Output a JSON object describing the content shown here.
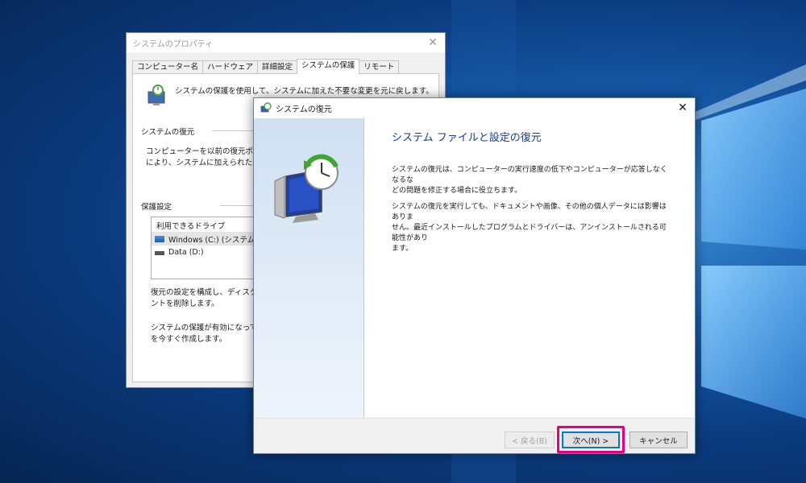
{
  "colors": {
    "accent": "#0078d7",
    "highlight": "#e5007e",
    "heading": "#1a3e7c"
  },
  "system_properties": {
    "title": "システムのプロパティ",
    "tabs": [
      {
        "label": "コンピューター名",
        "active": false
      },
      {
        "label": "ハードウェア",
        "active": false
      },
      {
        "label": "詳細設定",
        "active": false
      },
      {
        "label": "システムの保護",
        "active": true
      },
      {
        "label": "リモート",
        "active": false
      }
    ],
    "description": "システムの保護を使用して、システムに加えた不要な変更を元に戻します。",
    "restore_group": {
      "label": "システムの復元",
      "text_line1": "コンピューターを以前の復元ポイント",
      "text_line2": "により、システムに加えられた変更を"
    },
    "protection_group": {
      "label": "保護設定",
      "drives_header": "利用できるドライブ",
      "drives": [
        {
          "name": "Windows (C:) (システム)",
          "icon": "system-drive-icon"
        },
        {
          "name": "Data (D:)",
          "icon": "drive-icon"
        }
      ],
      "configure_line1": "復元の設定を構成し、ディスク領",
      "configure_line2": "ントを削除します。",
      "create_line1": "システムの保護が有効になってい",
      "create_line2": "を今すぐ作成します。"
    }
  },
  "system_restore": {
    "title": "システムの復元",
    "heading": "システム ファイルと設定の復元",
    "para1_line1": "システムの復元は、コンピューターの実行速度の低下やコンピューターが応答しなくなるな",
    "para1_line2": "どの問題を修正する場合に役立ちます。",
    "para2_line1": "システムの復元を実行しても、ドキュメントや画像、その他の個人データには影響はありま",
    "para2_line2": "せん。最近インストールしたプログラムとドライバーは、アンインストールされる可能性があり",
    "para2_line3": "ます。",
    "buttons": {
      "back": "< 戻る(B)",
      "next": "次へ(N) >",
      "cancel": "キャンセル"
    }
  }
}
